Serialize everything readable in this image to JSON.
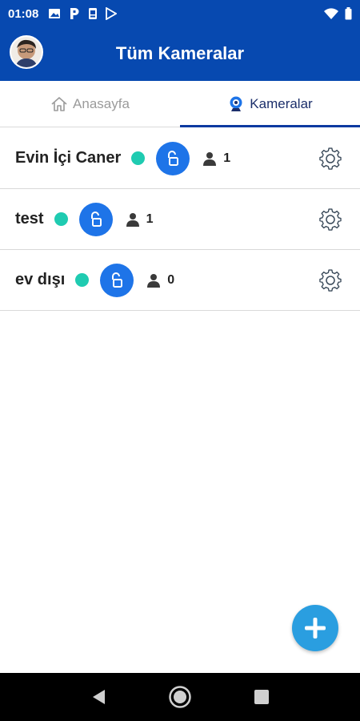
{
  "status_bar": {
    "time": "01:08",
    "left_icons": [
      "image-icon",
      "p-app-icon",
      "sim-icon",
      "play-store-icon"
    ],
    "right_icons": [
      "wifi-icon",
      "battery-icon"
    ]
  },
  "header": {
    "title": "Tüm Kameralar",
    "color": "#0749b0"
  },
  "tabs": [
    {
      "label": "Anasayfa",
      "icon": "home-icon",
      "active": false
    },
    {
      "label": "Kameralar",
      "icon": "webcam-icon",
      "active": true
    }
  ],
  "cameras": [
    {
      "name": "Evin İçi Caner",
      "online": true,
      "lock": "unlocked",
      "users": "1"
    },
    {
      "name": "test",
      "online": true,
      "lock": "unlocked",
      "users": "1"
    },
    {
      "name": "ev dışı",
      "online": true,
      "lock": "unlocked",
      "users": "0"
    }
  ],
  "colors": {
    "online_dot": "#1fcbb1",
    "lock_button": "#1e74e8",
    "fab": "#2a9ee0"
  },
  "fab_icon": "plus-icon",
  "nav_icons": [
    "back-icon",
    "home-circle-icon",
    "recents-icon"
  ]
}
